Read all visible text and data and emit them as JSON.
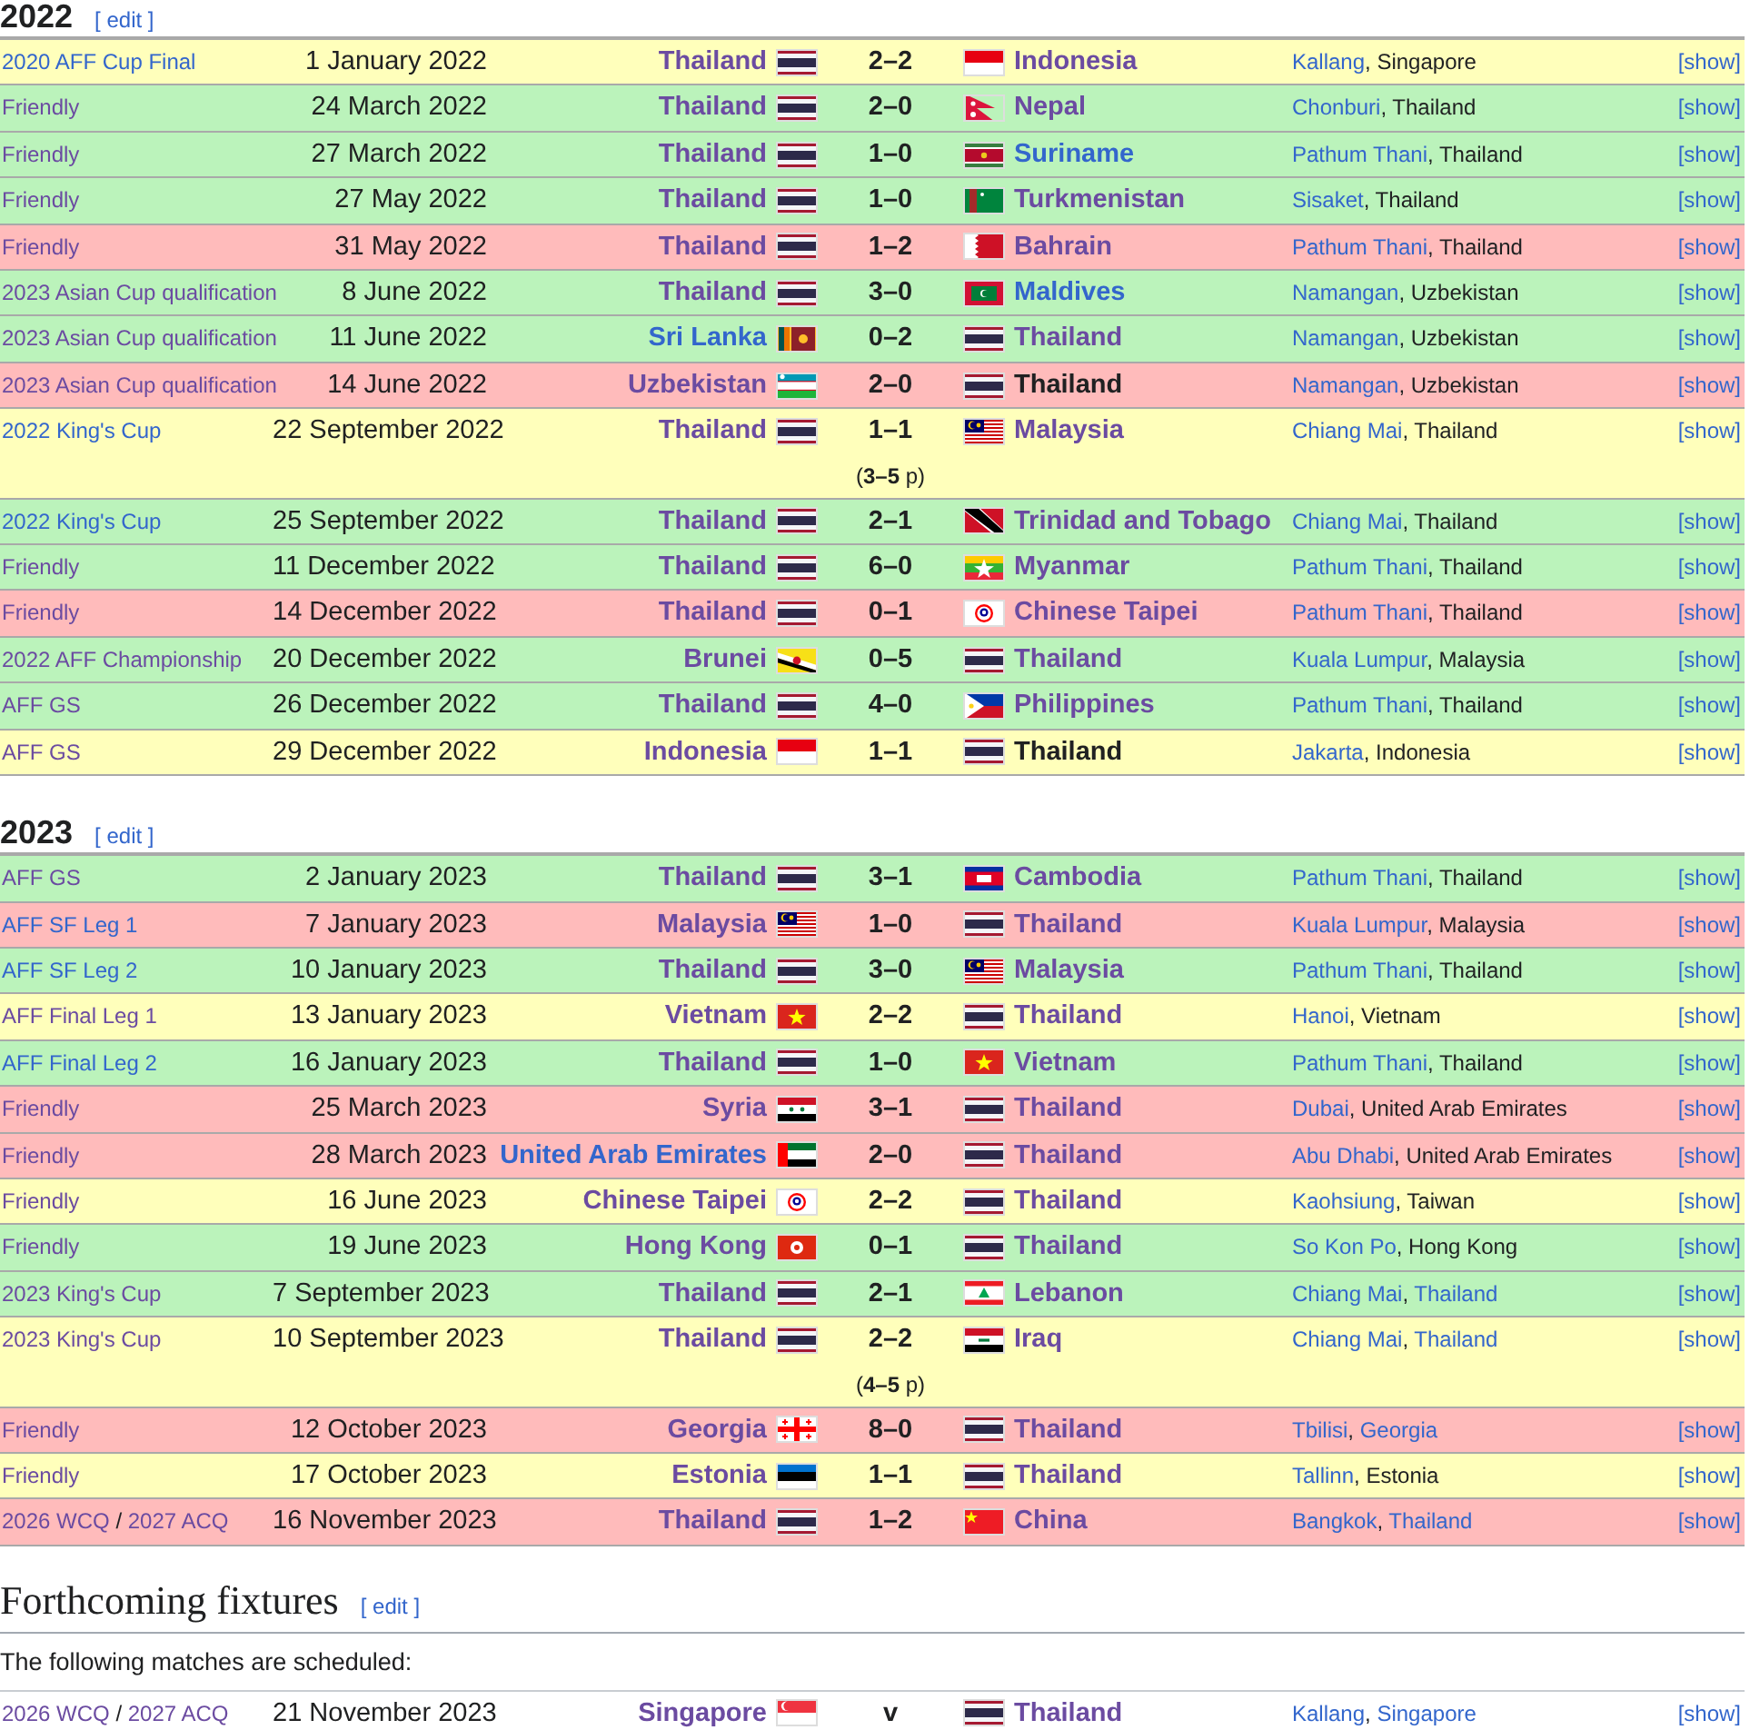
{
  "sections": [
    {
      "kind": "results",
      "title": "2022",
      "edit": "[ edit ]",
      "matches": [
        {
          "competition": [
            {
              "t": "2020 AFF Cup Final",
              "link": true,
              "visited": false
            }
          ],
          "date": "1 January 2022",
          "home": {
            "name": "Thailand",
            "flag": {
              "kind": "th"
            },
            "link": true,
            "visited": true
          },
          "score": "2–2",
          "away": {
            "name": "Indonesia",
            "flag": {
              "kind": "id"
            },
            "link": true,
            "visited": true
          },
          "venue": [
            {
              "t": "Kallang",
              "link": true,
              "visited": false
            },
            {
              "t": ", Singapore",
              "link": false
            }
          ],
          "details": "[show]",
          "color": "#ffffbb"
        },
        {
          "competition": [
            {
              "t": "Friendly",
              "link": true,
              "visited": true
            }
          ],
          "date": "24 March 2022",
          "home": {
            "name": "Thailand",
            "flag": {
              "kind": "th"
            },
            "link": true,
            "visited": true
          },
          "score": "2–0",
          "away": {
            "name": "Nepal",
            "flag": {
              "kind": "np"
            },
            "link": true,
            "visited": true
          },
          "venue": [
            {
              "t": "Chonburi",
              "link": true,
              "visited": false
            },
            {
              "t": ", Thailand",
              "link": false
            }
          ],
          "details": "[show]",
          "color": "#bbf3bb"
        },
        {
          "competition": [
            {
              "t": "Friendly",
              "link": true,
              "visited": true
            }
          ],
          "date": "27 March 2022",
          "home": {
            "name": "Thailand",
            "flag": {
              "kind": "th"
            },
            "link": true,
            "visited": true
          },
          "score": "1–0",
          "away": {
            "name": "Suriname",
            "flag": {
              "kind": "sr"
            },
            "link": true,
            "visited": false
          },
          "venue": [
            {
              "t": "Pathum Thani",
              "link": true,
              "visited": false
            },
            {
              "t": ", Thailand",
              "link": false
            }
          ],
          "details": "[show]",
          "color": "#bbf3bb"
        },
        {
          "competition": [
            {
              "t": "Friendly",
              "link": true,
              "visited": true
            }
          ],
          "date": "27 May 2022",
          "home": {
            "name": "Thailand",
            "flag": {
              "kind": "th"
            },
            "link": true,
            "visited": true
          },
          "score": "1–0",
          "away": {
            "name": "Turkmenistan",
            "flag": {
              "kind": "tm"
            },
            "link": true,
            "visited": true
          },
          "venue": [
            {
              "t": "Sisaket",
              "link": true,
              "visited": false
            },
            {
              "t": ", Thailand",
              "link": false
            }
          ],
          "details": "[show]",
          "color": "#bbf3bb"
        },
        {
          "competition": [
            {
              "t": "Friendly",
              "link": true,
              "visited": true
            }
          ],
          "date": "31 May 2022",
          "home": {
            "name": "Thailand",
            "flag": {
              "kind": "th"
            },
            "link": true,
            "visited": true
          },
          "score": "1–2",
          "away": {
            "name": "Bahrain",
            "flag": {
              "kind": "bh"
            },
            "link": true,
            "visited": true
          },
          "venue": [
            {
              "t": "Pathum Thani",
              "link": true,
              "visited": false
            },
            {
              "t": ", Thailand",
              "link": false
            }
          ],
          "details": "[show]",
          "color": "#ffbbbb"
        },
        {
          "competition": [
            {
              "t": "2023 Asian Cup qualification",
              "link": true,
              "visited": true
            }
          ],
          "date": "8 June 2022",
          "home": {
            "name": "Thailand",
            "flag": {
              "kind": "th"
            },
            "link": true,
            "visited": true
          },
          "score": "3–0",
          "away": {
            "name": "Maldives",
            "flag": {
              "kind": "mv"
            },
            "link": true,
            "visited": false
          },
          "venue": [
            {
              "t": "Namangan",
              "link": true,
              "visited": false
            },
            {
              "t": ", Uzbekistan",
              "link": false
            }
          ],
          "details": "[show]",
          "color": "#bbf3bb"
        },
        {
          "competition": [
            {
              "t": "2023 Asian Cup qualification",
              "link": true,
              "visited": true
            }
          ],
          "date": "11 June 2022",
          "home": {
            "name": "Sri Lanka",
            "flag": {
              "kind": "lk"
            },
            "link": true,
            "visited": false
          },
          "score": "0–2",
          "away": {
            "name": "Thailand",
            "flag": {
              "kind": "th"
            },
            "link": true,
            "visited": true
          },
          "venue": [
            {
              "t": "Namangan",
              "link": true,
              "visited": false
            },
            {
              "t": ", Uzbekistan",
              "link": false
            }
          ],
          "details": "[show]",
          "color": "#bbf3bb"
        },
        {
          "competition": [
            {
              "t": "2023 Asian Cup qualification",
              "link": true,
              "visited": true
            }
          ],
          "date": "14 June 2022",
          "home": {
            "name": "Uzbekistan",
            "flag": {
              "kind": "uz"
            },
            "link": true,
            "visited": true
          },
          "score": "2–0",
          "away": {
            "name": "Thailand",
            "flag": {
              "kind": "th"
            },
            "link": false
          },
          "venue": [
            {
              "t": "Namangan",
              "link": true,
              "visited": false
            },
            {
              "t": ", Uzbekistan",
              "link": false
            }
          ],
          "details": "[show]",
          "color": "#ffbbbb"
        },
        {
          "competition": [
            {
              "t": "2022 King's Cup",
              "link": true,
              "visited": false
            }
          ],
          "date": "22 September 2022",
          "home": {
            "name": "Thailand",
            "flag": {
              "kind": "th"
            },
            "link": true,
            "visited": true
          },
          "score": "1–1",
          "penalties": "(**3–5** p)",
          "away": {
            "name": "Malaysia",
            "flag": {
              "kind": "my"
            },
            "link": true,
            "visited": true
          },
          "venue": [
            {
              "t": "Chiang Mai",
              "link": true,
              "visited": false
            },
            {
              "t": ", Thailand",
              "link": false
            }
          ],
          "details": "[show]",
          "color": "#ffffbb"
        },
        {
          "competition": [
            {
              "t": "2022 King's Cup",
              "link": true,
              "visited": false
            }
          ],
          "date": "25 September 2022",
          "home": {
            "name": "Thailand",
            "flag": {
              "kind": "th"
            },
            "link": true,
            "visited": true
          },
          "score": "2–1",
          "away": {
            "name": "Trinidad and Tobago",
            "flag": {
              "kind": "tt"
            },
            "link": true,
            "visited": true
          },
          "venue": [
            {
              "t": "Chiang Mai",
              "link": true,
              "visited": false
            },
            {
              "t": ", Thailand",
              "link": false
            }
          ],
          "details": "[show]",
          "color": "#bbf3bb"
        },
        {
          "competition": [
            {
              "t": "Friendly",
              "link": true,
              "visited": true
            }
          ],
          "date": "11 December 2022",
          "home": {
            "name": "Thailand",
            "flag": {
              "kind": "th"
            },
            "link": true,
            "visited": true
          },
          "score": "6–0",
          "away": {
            "name": "Myanmar",
            "flag": {
              "kind": "mm"
            },
            "link": true,
            "visited": true
          },
          "venue": [
            {
              "t": "Pathum Thani",
              "link": true,
              "visited": false
            },
            {
              "t": ", Thailand",
              "link": false
            }
          ],
          "details": "[show]",
          "color": "#bbf3bb"
        },
        {
          "competition": [
            {
              "t": "Friendly",
              "link": true,
              "visited": true
            }
          ],
          "date": "14 December 2022",
          "home": {
            "name": "Thailand",
            "flag": {
              "kind": "th"
            },
            "link": true,
            "visited": true
          },
          "score": "0–1",
          "away": {
            "name": "Chinese Taipei",
            "flag": {
              "kind": "tpe"
            },
            "link": true,
            "visited": true
          },
          "venue": [
            {
              "t": "Pathum Thani",
              "link": true,
              "visited": false
            },
            {
              "t": ", Thailand",
              "link": false
            }
          ],
          "details": "[show]",
          "color": "#ffbbbb"
        },
        {
          "competition": [
            {
              "t": "2022 AFF Championship",
              "link": true,
              "visited": true
            }
          ],
          "date": "20 December 2022",
          "home": {
            "name": "Brunei",
            "flag": {
              "kind": "bn"
            },
            "link": true,
            "visited": true
          },
          "score": "0–5",
          "away": {
            "name": "Thailand",
            "flag": {
              "kind": "th"
            },
            "link": true,
            "visited": true
          },
          "venue": [
            {
              "t": "Kuala Lumpur",
              "link": true,
              "visited": false
            },
            {
              "t": ", Malaysia",
              "link": false
            }
          ],
          "details": "[show]",
          "color": "#bbf3bb"
        },
        {
          "competition": [
            {
              "t": "AFF GS",
              "link": true,
              "visited": true
            }
          ],
          "date": "26 December 2022",
          "home": {
            "name": "Thailand",
            "flag": {
              "kind": "th"
            },
            "link": true,
            "visited": true
          },
          "score": "4–0",
          "away": {
            "name": "Philippines",
            "flag": {
              "kind": "ph"
            },
            "link": true,
            "visited": true
          },
          "venue": [
            {
              "t": "Pathum Thani",
              "link": true,
              "visited": false
            },
            {
              "t": ", Thailand",
              "link": false
            }
          ],
          "details": "[show]",
          "color": "#bbf3bb"
        },
        {
          "competition": [
            {
              "t": "AFF GS",
              "link": true,
              "visited": true
            }
          ],
          "date": "29 December 2022",
          "home": {
            "name": "Indonesia",
            "flag": {
              "kind": "id"
            },
            "link": true,
            "visited": true
          },
          "score": "1–1",
          "away": {
            "name": "Thailand",
            "flag": {
              "kind": "th"
            },
            "link": false
          },
          "venue": [
            {
              "t": "Jakarta",
              "link": true,
              "visited": false
            },
            {
              "t": ", Indonesia",
              "link": false
            }
          ],
          "details": "[show]",
          "color": "#ffffbb"
        }
      ]
    },
    {
      "kind": "results",
      "title": "2023",
      "edit": "[ edit ]",
      "matches": [
        {
          "competition": [
            {
              "t": "AFF GS",
              "link": true,
              "visited": true
            }
          ],
          "date": "2 January 2023",
          "home": {
            "name": "Thailand",
            "flag": {
              "kind": "th"
            },
            "link": true,
            "visited": true
          },
          "score": "3–1",
          "away": {
            "name": "Cambodia",
            "flag": {
              "kind": "kh"
            },
            "link": true,
            "visited": true
          },
          "venue": [
            {
              "t": "Pathum Thani",
              "link": true,
              "visited": false
            },
            {
              "t": ", Thailand",
              "link": false
            }
          ],
          "details": "[show]",
          "color": "#bbf3bb"
        },
        {
          "competition": [
            {
              "t": "AFF SF Leg 1",
              "link": true,
              "visited": false
            }
          ],
          "date": "7 January 2023",
          "home": {
            "name": "Malaysia",
            "flag": {
              "kind": "my"
            },
            "link": true,
            "visited": true
          },
          "score": "1–0",
          "away": {
            "name": "Thailand",
            "flag": {
              "kind": "th"
            },
            "link": true,
            "visited": true
          },
          "venue": [
            {
              "t": "Kuala Lumpur",
              "link": true,
              "visited": false
            },
            {
              "t": ", Malaysia",
              "link": false
            }
          ],
          "details": "[show]",
          "color": "#ffbbbb"
        },
        {
          "competition": [
            {
              "t": "AFF SF Leg 2",
              "link": true,
              "visited": false
            }
          ],
          "date": "10 January 2023",
          "home": {
            "name": "Thailand",
            "flag": {
              "kind": "th"
            },
            "link": true,
            "visited": true
          },
          "score": "3–0",
          "away": {
            "name": "Malaysia",
            "flag": {
              "kind": "my"
            },
            "link": true,
            "visited": true
          },
          "venue": [
            {
              "t": "Pathum Thani",
              "link": true,
              "visited": false
            },
            {
              "t": ", Thailand",
              "link": false
            }
          ],
          "details": "[show]",
          "color": "#bbf3bb"
        },
        {
          "competition": [
            {
              "t": "AFF Final Leg 1",
              "link": true,
              "visited": true
            }
          ],
          "date": "13 January 2023",
          "home": {
            "name": "Vietnam",
            "flag": {
              "kind": "vn"
            },
            "link": true,
            "visited": true
          },
          "score": "2–2",
          "away": {
            "name": "Thailand",
            "flag": {
              "kind": "th"
            },
            "link": true,
            "visited": true
          },
          "venue": [
            {
              "t": "Hanoi",
              "link": true,
              "visited": false
            },
            {
              "t": ", Vietnam",
              "link": false
            }
          ],
          "details": "[show]",
          "color": "#ffffbb"
        },
        {
          "competition": [
            {
              "t": "AFF Final Leg 2",
              "link": true,
              "visited": false
            }
          ],
          "date": "16 January 2023",
          "home": {
            "name": "Thailand",
            "flag": {
              "kind": "th"
            },
            "link": true,
            "visited": true
          },
          "score": "1–0",
          "away": {
            "name": "Vietnam",
            "flag": {
              "kind": "vn"
            },
            "link": true,
            "visited": true
          },
          "venue": [
            {
              "t": "Pathum Thani",
              "link": true,
              "visited": false
            },
            {
              "t": ", Thailand",
              "link": false
            }
          ],
          "details": "[show]",
          "color": "#bbf3bb"
        },
        {
          "competition": [
            {
              "t": "Friendly",
              "link": true,
              "visited": true
            }
          ],
          "date": "25 March 2023",
          "home": {
            "name": "Syria",
            "flag": {
              "kind": "sy"
            },
            "link": true,
            "visited": true
          },
          "score": "3–1",
          "away": {
            "name": "Thailand",
            "flag": {
              "kind": "th"
            },
            "link": true,
            "visited": true
          },
          "venue": [
            {
              "t": "Dubai",
              "link": true,
              "visited": false
            },
            {
              "t": ", United Arab Emirates",
              "link": false
            }
          ],
          "details": "[show]",
          "color": "#ffbbbb"
        },
        {
          "competition": [
            {
              "t": "Friendly",
              "link": true,
              "visited": true
            }
          ],
          "date": "28 March 2023",
          "home": {
            "name": "United Arab Emirates",
            "flag": {
              "kind": "ae"
            },
            "link": true,
            "visited": false
          },
          "score": "2–0",
          "away": {
            "name": "Thailand",
            "flag": {
              "kind": "th"
            },
            "link": true,
            "visited": true
          },
          "venue": [
            {
              "t": "Abu Dhabi",
              "link": true,
              "visited": false
            },
            {
              "t": ", United Arab Emirates",
              "link": false
            }
          ],
          "details": "[show]",
          "color": "#ffbbbb"
        },
        {
          "competition": [
            {
              "t": "Friendly",
              "link": true,
              "visited": true
            }
          ],
          "date": "16 June 2023",
          "home": {
            "name": "Chinese Taipei",
            "flag": {
              "kind": "tpe"
            },
            "link": true,
            "visited": true
          },
          "score": "2–2",
          "away": {
            "name": "Thailand",
            "flag": {
              "kind": "th"
            },
            "link": true,
            "visited": true
          },
          "venue": [
            {
              "t": "Kaohsiung",
              "link": true,
              "visited": false
            },
            {
              "t": ", Taiwan",
              "link": false
            }
          ],
          "details": "[show]",
          "color": "#ffffbb"
        },
        {
          "competition": [
            {
              "t": "Friendly",
              "link": true,
              "visited": true
            }
          ],
          "date": "19 June 2023",
          "home": {
            "name": "Hong Kong",
            "flag": {
              "kind": "hk"
            },
            "link": true,
            "visited": true
          },
          "score": "0–1",
          "away": {
            "name": "Thailand",
            "flag": {
              "kind": "th"
            },
            "link": true,
            "visited": true
          },
          "venue": [
            {
              "t": "So Kon Po",
              "link": true,
              "visited": false
            },
            {
              "t": ", Hong Kong",
              "link": false
            }
          ],
          "details": "[show]",
          "color": "#bbf3bb"
        },
        {
          "competition": [
            {
              "t": "2023 King's Cup",
              "link": true,
              "visited": true
            }
          ],
          "date": "7 September 2023",
          "home": {
            "name": "Thailand",
            "flag": {
              "kind": "th"
            },
            "link": true,
            "visited": true
          },
          "score": "2–1",
          "away": {
            "name": "Lebanon",
            "flag": {
              "kind": "lb"
            },
            "link": true,
            "visited": true
          },
          "venue": [
            {
              "t": "Chiang Mai",
              "link": true,
              "visited": false
            },
            {
              "t": ", ",
              "link": false
            },
            {
              "t": "Thailand",
              "link": true,
              "visited": false
            }
          ],
          "details": "[show]",
          "color": "#bbf3bb"
        },
        {
          "competition": [
            {
              "t": "2023 King's Cup",
              "link": true,
              "visited": true
            }
          ],
          "date": "10 September 2023",
          "home": {
            "name": "Thailand",
            "flag": {
              "kind": "th"
            },
            "link": true,
            "visited": true
          },
          "score": "2–2",
          "penalties": "(**4–5** p)",
          "away": {
            "name": "Iraq",
            "flag": {
              "kind": "iq"
            },
            "link": true,
            "visited": true
          },
          "venue": [
            {
              "t": "Chiang Mai",
              "link": true,
              "visited": false
            },
            {
              "t": ", ",
              "link": false
            },
            {
              "t": "Thailand",
              "link": true,
              "visited": false
            }
          ],
          "details": "[show]",
          "color": "#ffffbb"
        },
        {
          "competition": [
            {
              "t": "Friendly",
              "link": true,
              "visited": true
            }
          ],
          "date": "12 October 2023",
          "home": {
            "name": "Georgia",
            "flag": {
              "kind": "ge"
            },
            "link": true,
            "visited": true
          },
          "score": "8–0",
          "away": {
            "name": "Thailand",
            "flag": {
              "kind": "th"
            },
            "link": true,
            "visited": true
          },
          "venue": [
            {
              "t": "Tbilisi",
              "link": true,
              "visited": false
            },
            {
              "t": ", ",
              "link": false
            },
            {
              "t": "Georgia",
              "link": true,
              "visited": false
            }
          ],
          "details": "[show]",
          "color": "#ffbbbb"
        },
        {
          "competition": [
            {
              "t": "Friendly",
              "link": true,
              "visited": true
            }
          ],
          "date": "17 October 2023",
          "home": {
            "name": "Estonia",
            "flag": {
              "kind": "ee"
            },
            "link": true,
            "visited": true
          },
          "score": "1–1",
          "away": {
            "name": "Thailand",
            "flag": {
              "kind": "th"
            },
            "link": true,
            "visited": true
          },
          "venue": [
            {
              "t": "Tallinn",
              "link": true,
              "visited": false
            },
            {
              "t": ", Estonia",
              "link": false
            }
          ],
          "details": "[show]",
          "color": "#ffffbb"
        },
        {
          "competition": [
            {
              "t": "2026 WCQ",
              "link": true,
              "visited": true
            },
            {
              "t": " / ",
              "link": false
            },
            {
              "t": "2027 ACQ",
              "link": true,
              "visited": true
            }
          ],
          "date": "16 November 2023",
          "home": {
            "name": "Thailand",
            "flag": {
              "kind": "th"
            },
            "link": true,
            "visited": true
          },
          "score": "1–2",
          "away": {
            "name": "China",
            "flag": {
              "kind": "cn"
            },
            "link": true,
            "visited": true
          },
          "venue": [
            {
              "t": "Bangkok",
              "link": true,
              "visited": false
            },
            {
              "t": ", ",
              "link": false
            },
            {
              "t": "Thailand",
              "link": true,
              "visited": false
            }
          ],
          "details": "[show]",
          "color": "#ffbbbb"
        }
      ]
    },
    {
      "kind": "fixtures",
      "title": "Forthcoming fixtures",
      "edit": "[ edit ]",
      "intro": "The following matches are scheduled:",
      "matches": [
        {
          "competition": [
            {
              "t": "2026 WCQ",
              "link": true,
              "visited": true
            },
            {
              "t": " / ",
              "link": false
            },
            {
              "t": "2027 ACQ",
              "link": true,
              "visited": true
            }
          ],
          "date": "21 November 2023",
          "home": {
            "name": "Singapore",
            "flag": {
              "kind": "sg"
            },
            "link": true,
            "visited": true
          },
          "score": "v",
          "away": {
            "name": "Thailand",
            "flag": {
              "kind": "th"
            },
            "link": true,
            "visited": true
          },
          "venue": [
            {
              "t": "Kallang",
              "link": true,
              "visited": false
            },
            {
              "t": ", ",
              "link": false
            },
            {
              "t": "Singapore",
              "link": true,
              "visited": false
            }
          ],
          "details": "[show]",
          "color": "#ffffff"
        }
      ]
    }
  ]
}
